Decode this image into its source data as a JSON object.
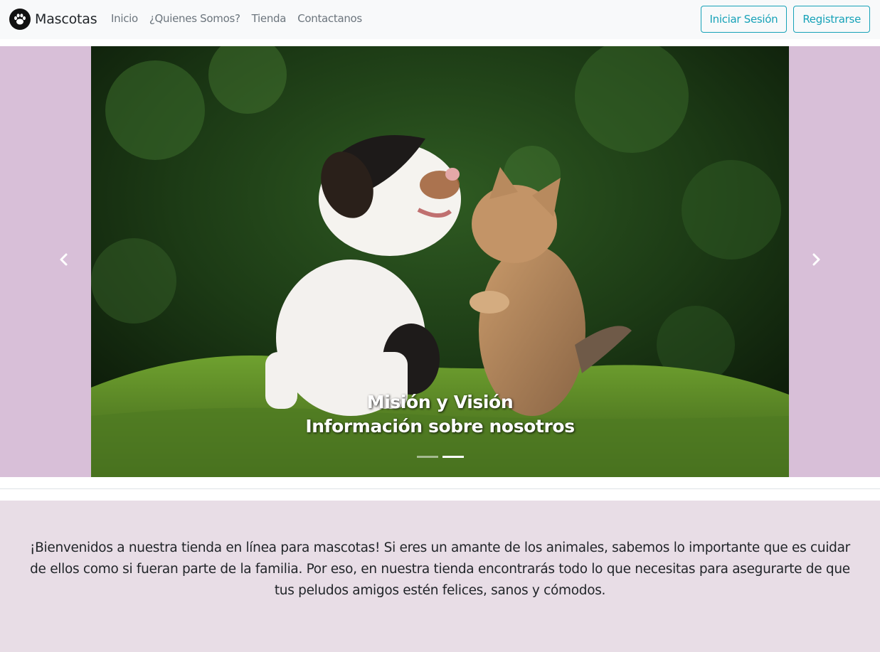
{
  "navbar": {
    "brand": "Mascotas",
    "brand_icon": "paw-icon",
    "links": [
      "Inicio",
      "¿Quienes Somos?",
      "Tienda",
      "Contactanos"
    ],
    "login_label": "Iniciar Sesión",
    "register_label": "Registrarse",
    "accent_color": "#17a2b8"
  },
  "carousel": {
    "background_color": "#d8bfd8",
    "caption_title": "Misión y Visión",
    "caption_subtitle": "Información sobre nosotros",
    "slide_count": 2,
    "active_slide": 2,
    "prev_icon": "chevron-left-icon",
    "next_icon": "chevron-right-icon"
  },
  "welcome": {
    "text": "¡Bienvenidos a nuestra tienda en línea para mascotas! Si eres un amante de los animales, sabemos lo importante que es cuidar de ellos como si fueran parte de la familia. Por eso, en nuestra tienda encontrarás todo lo que necesitas para asegurarte de que tus peludos amigos estén felices, sanos y cómodos.",
    "background_color": "#e8dde6"
  }
}
